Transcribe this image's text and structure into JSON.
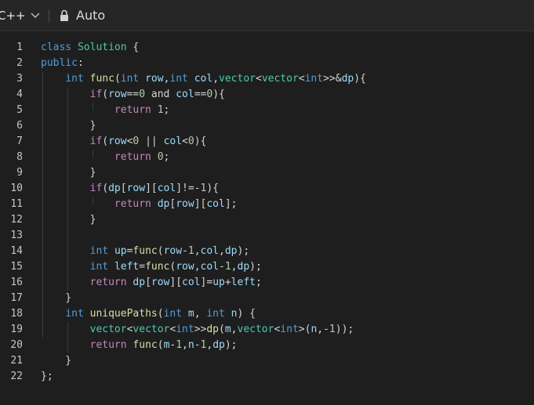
{
  "toolbar": {
    "language": "C++",
    "mode": "Auto",
    "icons": [
      "chevron-down-icon",
      "lock-icon"
    ]
  },
  "colors": {
    "keyword": "#569cd6",
    "type": "#4ec9b0",
    "function": "#dcdcaa",
    "control": "#c586c0",
    "variable": "#9cdcfe",
    "number": "#b5cea8",
    "plain": "#d4d4d4"
  },
  "editor": {
    "lines": [
      {
        "n": "1",
        "html": "<span class=\"kw\">class</span> <span class=\"ty\">Solution</span> {"
      },
      {
        "n": "2",
        "html": "<span class=\"kw\">public</span>:"
      },
      {
        "n": "3",
        "html": "    <span class=\"kw\">int</span> <span class=\"fn\">func</span>(<span class=\"kw\">int</span> <span class=\"vr\">row</span>,<span class=\"kw\">int</span> <span class=\"vr\">col</span>,<span class=\"ty\">vector</span>&lt;<span class=\"ty\">vector</span>&lt;<span class=\"kw\">int</span>&gt;&gt;&amp;<span class=\"vr\">dp</span>){"
      },
      {
        "n": "4",
        "html": "        <span class=\"ct\">if</span>(<span class=\"vr\">row</span>==<span class=\"nm\">0</span> and <span class=\"vr\">col</span>==<span class=\"nm\">0</span>){"
      },
      {
        "n": "5",
        "html": "            <span class=\"ct\">return</span> <span class=\"nm\">1</span>;"
      },
      {
        "n": "6",
        "html": "        }"
      },
      {
        "n": "7",
        "html": "        <span class=\"ct\">if</span>(<span class=\"vr\">row</span>&lt;<span class=\"nm\">0</span> || <span class=\"vr\">col</span>&lt;<span class=\"nm\">0</span>){"
      },
      {
        "n": "8",
        "html": "            <span class=\"ct\">return</span> <span class=\"nm\">0</span>;"
      },
      {
        "n": "9",
        "html": "        }"
      },
      {
        "n": "10",
        "html": "        <span class=\"ct\">if</span>(<span class=\"vr\">dp</span>[<span class=\"vr\">row</span>][<span class=\"vr\">col</span>]!=-<span class=\"nm\">1</span>){"
      },
      {
        "n": "11",
        "html": "            <span class=\"ct\">return</span> <span class=\"vr\">dp</span>[<span class=\"vr\">row</span>][<span class=\"vr\">col</span>];"
      },
      {
        "n": "12",
        "html": "        }"
      },
      {
        "n": "13",
        "html": ""
      },
      {
        "n": "14",
        "html": "        <span class=\"kw\">int</span> <span class=\"vr\">up</span>=<span class=\"fn\">func</span>(<span class=\"vr\">row</span>-<span class=\"nm\">1</span>,<span class=\"vr\">col</span>,<span class=\"vr\">dp</span>);"
      },
      {
        "n": "15",
        "html": "        <span class=\"kw\">int</span> <span class=\"vr\">left</span>=<span class=\"fn\">func</span>(<span class=\"vr\">row</span>,<span class=\"vr\">col</span>-<span class=\"nm\">1</span>,<span class=\"vr\">dp</span>);"
      },
      {
        "n": "16",
        "html": "        <span class=\"ct\">return</span> <span class=\"vr\">dp</span>[<span class=\"vr\">row</span>][<span class=\"vr\">col</span>]=<span class=\"vr\">up</span>+<span class=\"vr\">left</span>;"
      },
      {
        "n": "17",
        "html": "    }"
      },
      {
        "n": "18",
        "html": "    <span class=\"kw\">int</span> <span class=\"fn\">uniquePaths</span>(<span class=\"kw\">int</span> <span class=\"vr\">m</span>, <span class=\"kw\">int</span> <span class=\"vr\">n</span>) {"
      },
      {
        "n": "19",
        "html": "        <span class=\"ty\">vector</span>&lt;<span class=\"ty\">vector</span>&lt;<span class=\"kw\">int</span>&gt;&gt;<span class=\"fn\">dp</span>(<span class=\"vr\">m</span>,<span class=\"ty\">vector</span>&lt;<span class=\"kw\">int</span>&gt;(<span class=\"vr\">n</span>,-<span class=\"nm\">1</span>));"
      },
      {
        "n": "20",
        "html": "        <span class=\"ct\">return</span> <span class=\"fn\">func</span>(<span class=\"vr\">m</span>-<span class=\"nm\">1</span>,<span class=\"vr\">n</span>-<span class=\"nm\">1</span>,<span class=\"vr\">dp</span>);"
      },
      {
        "n": "21",
        "html": "    }"
      },
      {
        "n": "22",
        "html": "};"
      }
    ]
  }
}
